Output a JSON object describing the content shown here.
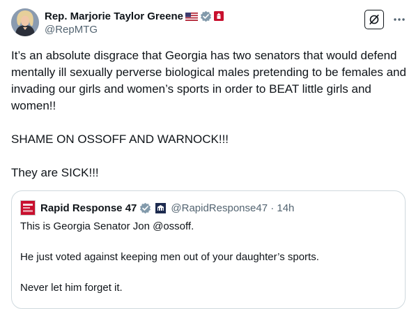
{
  "author": {
    "name": "Rep. Marjorie Taylor Greene",
    "handle": "@RepMTG",
    "flag_icon": "us-flag-icon",
    "verified_icon": "gray-verified-badge-icon",
    "affiliation_icon": "us-house-seal-icon"
  },
  "tweet": {
    "paragraphs": [
      "It’s an absolute disgrace that Georgia has two senators that would defend mentally ill sexually perverse biological males pretending to be females and invading our girls and women’s sports in order to BEAT little girls and women!!",
      "SHAME ON OSSOFF AND WARNOCK!!!",
      "They are SICK!!!"
    ]
  },
  "quoted": {
    "name": "Rapid Response 47",
    "handle_time": "@RapidResponse47 · 14h",
    "logo_icon": "rapid-response-47-logo-icon",
    "verified_icon": "gray-verified-badge-icon",
    "affiliation_icon": "white-house-affiliation-icon",
    "lines": [
      "This is Georgia Senator Jon @ossoff.",
      "He just voted against keeping men out of your daughter’s sports.",
      "Never let him forget it."
    ]
  },
  "actions": {
    "grok_icon": "grok-icon",
    "more_icon": "more-options-icon"
  },
  "colors": {
    "text": "#0f1419",
    "secondary": "#536471",
    "border": "#cfd9de",
    "verified_gray": "#829aab"
  }
}
